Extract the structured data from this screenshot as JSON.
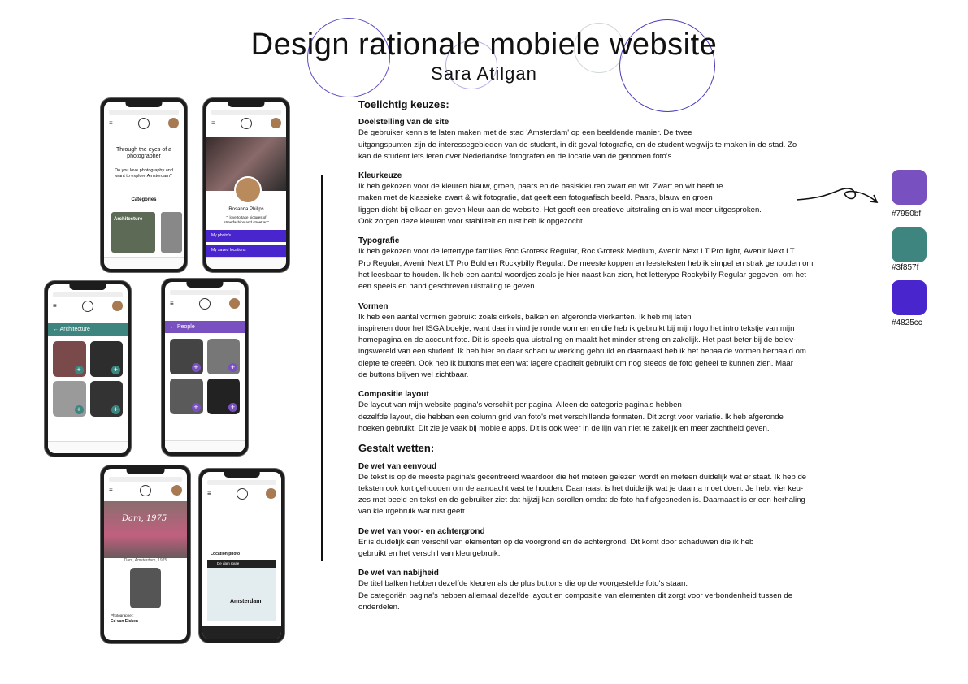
{
  "header": {
    "title": "Design rationale mobiele website",
    "author": "Sara Atilgan"
  },
  "colors": {
    "purple": "#7950bf",
    "green": "#3f857f",
    "blue_purple": "#4825cc"
  },
  "swatches": [
    {
      "label": "#7950bf",
      "color": "#7950bf"
    },
    {
      "label": "#3f857f",
      "color": "#3f857f"
    },
    {
      "label": "#4825cc",
      "color": "#4825cc"
    }
  ],
  "phones": {
    "home_heading": "Through the eyes of a photographer",
    "home_question": "Do you love photography and want to explore Amsterdam?",
    "home_categories": "Categories",
    "home_tile": "Architecture",
    "profile_name": "Rosanna Philips",
    "profile_quote": "\"I love to take pictures of streetfashion and street art\"",
    "profile_btn1": "My photo's",
    "profile_btn2": "My saved locations",
    "arch_bar": "Architecture",
    "people_bar": "People",
    "detail_overlay": "Dam, 1975",
    "detail_caption": "Dam, Amsterdam, 1975",
    "detail_photographer_label": "Photographer:",
    "detail_photographer": "Ed van Elsken",
    "map_location": "Location photo",
    "map_route": "De dam route",
    "map_city": "Amsterdam"
  },
  "sections": {
    "toelichting": "Toelichtig keuzes:",
    "doel_h": "Doelstelling van de site",
    "doel_p": "De gebruiker kennis te laten maken met de stad 'Amsterdam' op een beeldende manier. De twee\nuitgangspunten zijn de interessegebieden van de student, in dit geval fotografie, en de student wegwijs te maken in de stad. Zo\nkan de student iets leren over Nederlandse fotografen en de locatie van de genomen foto's.",
    "kleur_h": "Kleurkeuze",
    "kleur_p": "Ik heb gekozen voor de kleuren blauw, groen, paars en de basiskleuren zwart en wit. Zwart en wit heeft te\nmaken met de klassieke zwart & wit fotografie, dat geeft een fotografisch beeld. Paars, blauw en groen\nliggen dicht bij elkaar en geven kleur aan de website. Het geeft een creatieve uitstraling en is wat meer uitgesproken.\nOok zorgen deze kleuren voor stabiliteit en rust heb ik opgezocht.",
    "typo_h": "Typografie",
    "typo_p": "Ik heb gekozen voor de lettertype families Roc Grotesk Regular, Roc Grotesk Medium, Avenir Next LT Pro light, Avenir Next LT\nPro Regular, Avenir Next LT Pro Bold en Rockybilly Regular. De meeste koppen en leesteksten heb ik simpel en strak gehouden om\nhet leesbaar te houden. Ik heb een aantal woordjes zoals je hier naast kan zien, het letterype Rockybilly Regular gegeven, om het\neen speels en hand geschreven uistraling te geven.",
    "vorm_h": "Vormen",
    "vorm_p": "Ik heb een aantal vormen gebruikt zoals cirkels, balken en afgeronde vierkanten. Ik heb mij laten\ninspireren door het ISGA boekje, want daarin vind je ronde vormen en die heb ik gebruikt bij mijn logo het intro tekstje van mijn\nhomepagina en de account foto. Dit is speels qua uistraling en maakt het minder streng en zakelijk. Het past beter bij de belev-\ningswereld van een student. Ik heb hier en daar schaduw werking gebruikt en daarnaast heb ik het bepaalde vormen herhaald om\ndiepte te creeën. Ook heb ik buttons met een wat lagere opaciteit gebruikt om nog steeds de foto geheel te kunnen zien. Maar\nde buttons blijven wel zichtbaar.",
    "comp_h": "Compositie layout",
    "comp_p": "De layout van mijn website pagina's verschilt per pagina. Alleen de categorie pagina's hebben\ndezelfde layout, die hebben een column grid van foto's met verschillende formaten. Dit zorgt voor variatie. Ik heb afgeronde\nhoeken gebruikt. Dit zie je vaak bij mobiele apps. Dit is ook weer in de lijn van niet te zakelijk en meer zachtheid geven.",
    "gestalt": "Gestalt wetten:",
    "eenv_h": "De wet van eenvoud",
    "eenv_p": "De tekst is op de meeste pagina's gecentreerd waardoor die het meteen gelezen wordt en meteen duidelijk wat er staat. Ik heb de\nteksten ook kort gehouden om de aandacht vast te houden. Daarnaast is het duidelijk wat je daarna moet doen. Je hebt vier keu-\nzes met beeld en tekst en de gebruiker ziet dat hij/zij kan scrollen omdat de foto half afgesneden is. Daarnaast is er een herhaling\nvan kleurgebruik wat rust geeft.",
    "voor_h": "De wet van voor- en achtergrond",
    "voor_p": "Er is duidelijk een verschil van elementen op de voorgrond en de achtergrond. Dit komt door schaduwen die ik heb\ngebruikt en het verschil van kleurgebruik.",
    "nabij_h": "De wet van nabijheid",
    "nabij_p": "De titel balken hebben dezelfde kleuren als de plus buttons die op de voorgestelde foto's staan.\nDe categoriën pagina's hebben allemaal dezelfde layout en compositie van elementen dit zorgt voor verbondenheid tussen de\nonderdelen."
  }
}
